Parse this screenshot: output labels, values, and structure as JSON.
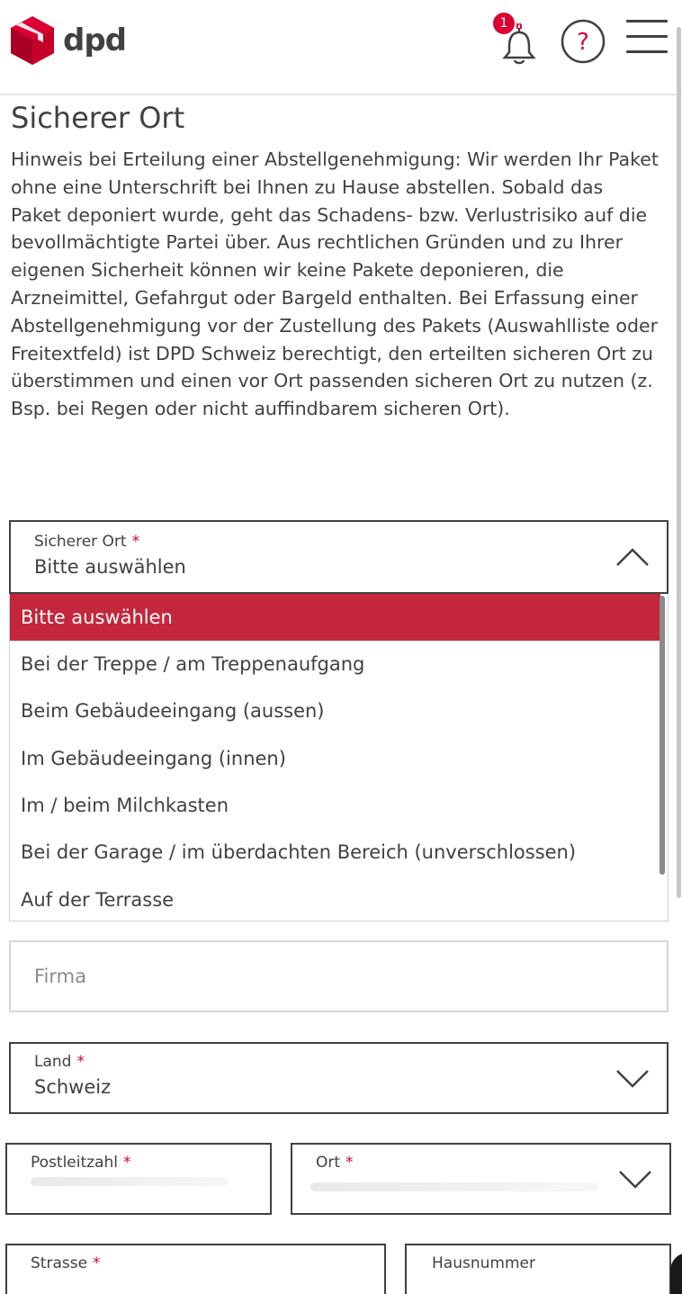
{
  "header": {
    "brand": "dpd",
    "notification_count": "1",
    "notification_sub": "n"
  },
  "content": {
    "title": "Sicherer Ort",
    "hint": "Hinweis bei Erteilung einer Abstellgenehmigung: Wir werden Ihr Paket ohne eine Unterschrift bei Ihnen zu Hause abstellen. Sobald das Paket deponiert wurde, geht das Schadens- bzw. Verlustrisiko auf die bevollmächtigte Partei über. Aus rechtlichen Gründen und zu Ihrer eigenen Sicherheit können wir keine Pakete deponieren, die Arzneimittel, Gefahrgut oder Bargeld enthalten. Bei Erfassung einer Abstellgenehmigung vor der Zustellung des Pakets (Auswahlliste oder Freitextfeld) ist DPD Schweiz berechtigt, den erteilten sicheren Ort zu überstimmen und einen vor Ort passenden sicheren Ort zu nutzen (z. Bsp. bei Regen oder nicht auffindbarem sicheren Ort)."
  },
  "form": {
    "safe_place": {
      "label": "Sicherer Ort",
      "required_mark": "*",
      "value": "Bitte auswählen",
      "options": [
        "Bitte auswählen",
        "Bei der Treppe / am Treppenaufgang",
        "Beim Gebäudeeingang (aussen)",
        "Im Gebäudeeingang (innen)",
        "Im / beim Milchkasten",
        "Bei der Garage / im überdachten Bereich (unverschlossen)",
        "Auf der Terrasse"
      ]
    },
    "company": {
      "placeholder": "Firma"
    },
    "country": {
      "label": "Land",
      "required_mark": "*",
      "value": "Schweiz"
    },
    "postal_code": {
      "label": "Postleitzahl",
      "required_mark": "*"
    },
    "city": {
      "label": "Ort",
      "required_mark": "*"
    },
    "street": {
      "label": "Strasse",
      "required_mark": "*"
    },
    "house_number": {
      "label": "Hausnummer"
    }
  },
  "colors": {
    "brand_red": "#dc0032",
    "selected_option": "#c4263b",
    "text": "#414042"
  }
}
